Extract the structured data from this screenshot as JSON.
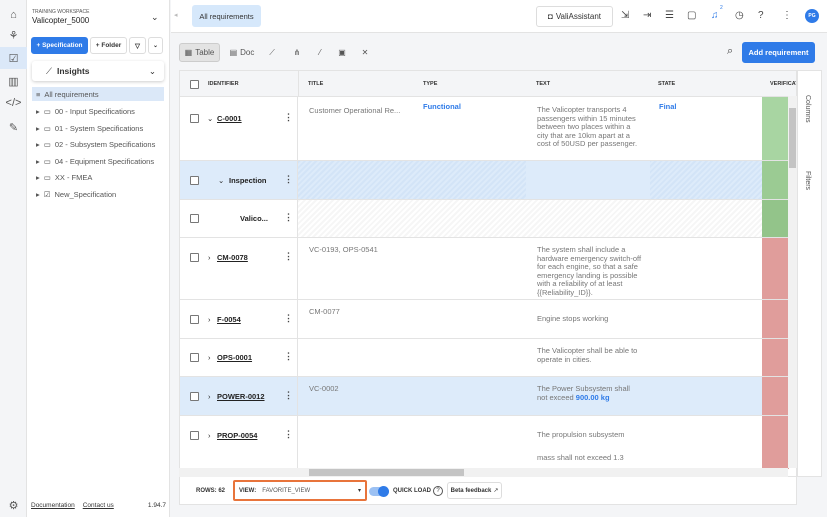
{
  "rail": {
    "icons": [
      "home-icon",
      "sitemap-icon",
      "clipboard-icon",
      "analytics-icon",
      "code-icon",
      "pencil-icon",
      "gear-icon"
    ]
  },
  "sidebar": {
    "workspace_label": "TRAINING WORKSPACE",
    "workspace_name": "Valicopter_5000",
    "add_spec": "+ Specification",
    "add_folder": "+ Folder",
    "insights": "Insights",
    "items": [
      {
        "label": "All requirements"
      },
      {
        "label": "00 - Input Specifications"
      },
      {
        "label": "01 - System Specifications"
      },
      {
        "label": "02 - Subsystem Specifications"
      },
      {
        "label": "04 - Equipment Specifications"
      },
      {
        "label": "XX - FMEA"
      },
      {
        "label": "New_Specification"
      }
    ],
    "documentation": "Documentation",
    "contact": "Contact us",
    "version": "1.94.7"
  },
  "topbar": {
    "tab": "All requirements",
    "assistant": "ValiAssistant",
    "notif_count": "2",
    "avatar": "PG"
  },
  "toolbar": {
    "table": "Table",
    "doc": "Doc",
    "add_requirement": "Add requirement"
  },
  "table": {
    "columns": [
      "IDENTIFIER",
      "TITLE",
      "TYPE",
      "TEXT",
      "STATE",
      "VERIFICAT"
    ],
    "rows": [
      {
        "id": "C-0001",
        "title": "Customer Operational Re...",
        "type": "Functional",
        "text": "The Valicopter transports 4 passengers within 15 minutes between two places within a city that are 10km apart at a cost of 50USD per passenger.",
        "state": "Final",
        "ver": "#a8d5a2"
      },
      {
        "id": "Inspection",
        "title": "",
        "type": "",
        "text": "",
        "state": "",
        "ver": "#9bcb93"
      },
      {
        "id": "Valico...",
        "title": "",
        "type": "",
        "text": "",
        "state": "",
        "ver": "#93c48a"
      },
      {
        "id": "CM-0078",
        "title": "VC-0193, OPS-0541",
        "type": "",
        "text": "The system shall include a hardware emergency switch-off for each engine, so that a safe emergency landing is possible with a reliability of at least {{Reliability_ID}}.",
        "state": "",
        "ver": "#e09d9b"
      },
      {
        "id": "F-0054",
        "title": "CM-0077",
        "type": "",
        "text": "Engine stops working",
        "state": "",
        "ver": "#e09d9b"
      },
      {
        "id": "OPS-0001",
        "title": "",
        "type": "",
        "text": "The Valicopter shall be able to operate in cities.",
        "state": "",
        "ver": "#e09d9b"
      },
      {
        "id": "POWER-0012",
        "title": "VC-0002",
        "type": "",
        "text": "The Power Subsystem shall not exceed ",
        "text_value": "900.00  kg",
        "state": "",
        "ver": "#e09d9b"
      },
      {
        "id": "PROP-0054",
        "title": "",
        "type": "",
        "text": "The propulsion subsystem",
        "text2": "mass shall not exceed 1.3",
        "state": "",
        "ver": "#e09d9b"
      }
    ]
  },
  "sidepanel": {
    "columns": "Columns",
    "filters": "Filters"
  },
  "footer": {
    "rows_label": "ROWS: 62",
    "view_label": "VIEW:",
    "view_value": "FAVORITE_VIEW",
    "quick_load": "QUICK LOAD",
    "beta": "Beta feedback"
  }
}
